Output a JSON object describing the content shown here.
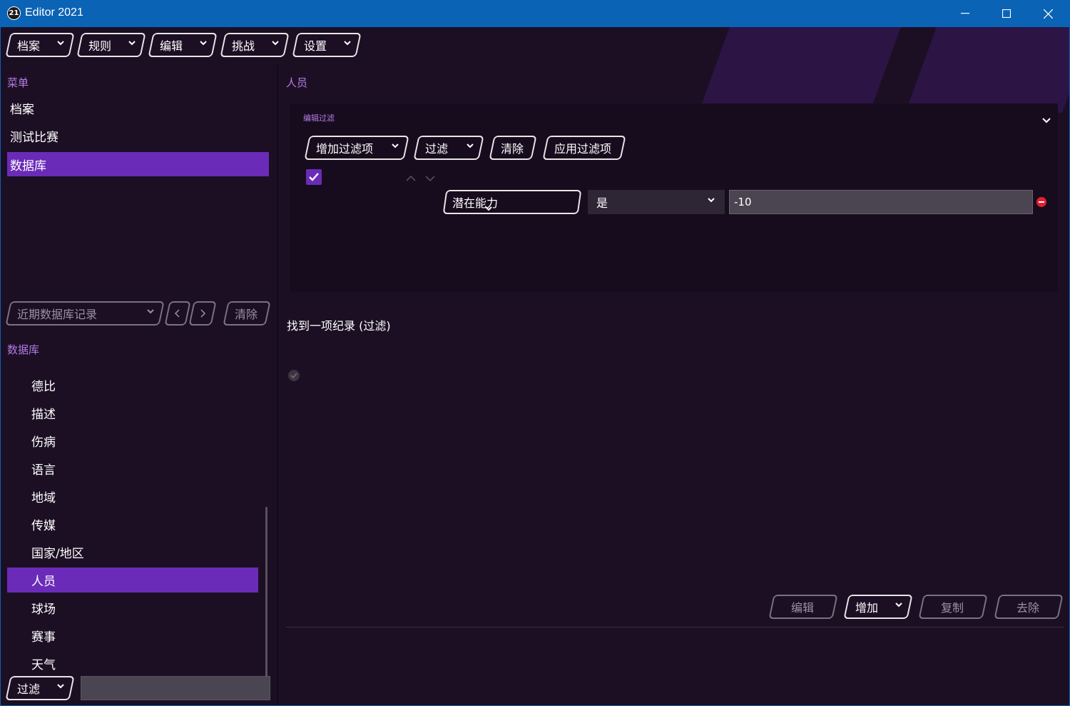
{
  "window": {
    "title": "Editor 2021",
    "app_icon_text": "21"
  },
  "toolbar": {
    "items": [
      "档案",
      "规则",
      "编辑",
      "挑战",
      "设置"
    ]
  },
  "sidebar": {
    "menu_label": "菜单",
    "menu_items": [
      "档案",
      "测试比赛",
      "数据库"
    ],
    "recent_placeholder": "近期数据库记录",
    "clear_label": "清除",
    "db_label": "数据库",
    "db_items": [
      "德比",
      "描述",
      "伤病",
      "语言",
      "地域",
      "传媒",
      "国家/地区",
      "人员",
      "球场",
      "赛事",
      "天气"
    ],
    "filter_label": "过滤"
  },
  "content": {
    "heading": "人员",
    "edit_filter_label": "编辑过滤",
    "filter_buttons": {
      "add_filter": "增加过滤项",
      "filter": "过滤",
      "clear": "清除",
      "apply": "应用过滤项"
    },
    "rule": {
      "field": "潜在能力",
      "operator": "是",
      "value": "-10"
    },
    "result_text": "找到一项纪录 (过滤)",
    "actions": {
      "edit": "编辑",
      "add": "增加",
      "copy": "复制",
      "remove": "去除"
    }
  },
  "colors": {
    "accent": "#6a2bb8",
    "label_purple": "#b57be8",
    "titlebar": "#0b63b6",
    "background": "#1c0f24"
  }
}
